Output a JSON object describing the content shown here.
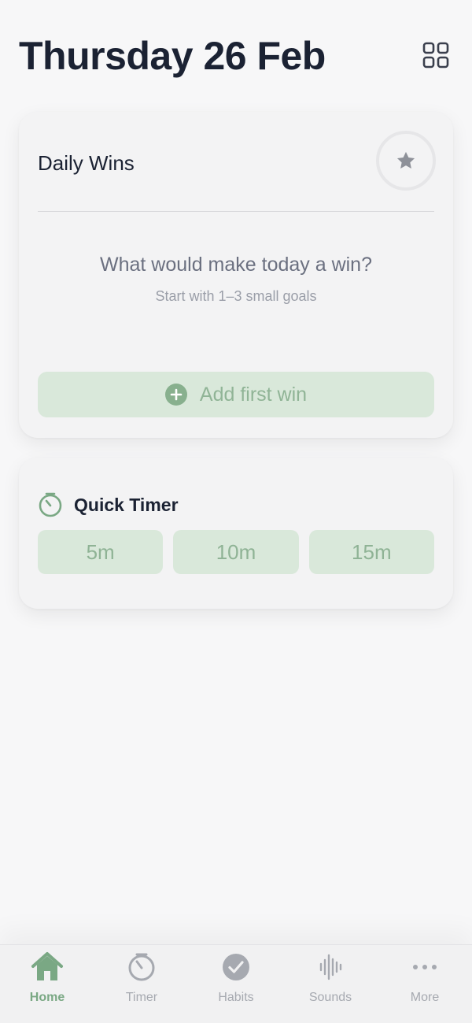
{
  "header": {
    "date_title": "Thursday 26 Feb"
  },
  "daily_wins": {
    "title": "Daily Wins",
    "prompt": "What would make today a win?",
    "hint": "Start with 1–3 small goals",
    "add_button_label": "Add first win"
  },
  "quick_timer": {
    "title": "Quick Timer",
    "presets": [
      "5m",
      "10m",
      "15m"
    ]
  },
  "tabs": [
    {
      "label": "Home",
      "icon": "home-icon",
      "active": true
    },
    {
      "label": "Timer",
      "icon": "timer-icon",
      "active": false
    },
    {
      "label": "Habits",
      "icon": "check-circle-icon",
      "active": false
    },
    {
      "label": "Sounds",
      "icon": "sound-wave-icon",
      "active": false
    },
    {
      "label": "More",
      "icon": "more-icon",
      "active": false
    }
  ],
  "colors": {
    "accent": "#7aa884",
    "accent_soft": "#d9e8da",
    "title": "#1b2233",
    "muted": "#a6a9b0"
  }
}
